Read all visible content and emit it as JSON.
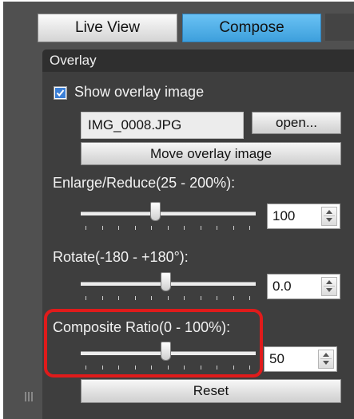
{
  "tabs": {
    "live_view": "Live View",
    "compose": "Compose",
    "active": "Compose"
  },
  "panel": {
    "title": "Overlay",
    "show_overlay": {
      "label": "Show overlay image",
      "checked": true
    },
    "file_name": "IMG_0008.JPG",
    "open_button": "open...",
    "move_button": "Move overlay image",
    "enlarge": {
      "label": "Enlarge/Reduce(25 - 200%):",
      "value": "100",
      "min": 25,
      "max": 200
    },
    "rotate": {
      "label": "Rotate(-180 - +180°):",
      "value": "0.0",
      "min": -180,
      "max": 180
    },
    "composite": {
      "label": "Composite Ratio(0 - 100%):",
      "value": "50",
      "min": 0,
      "max": 100
    },
    "reset_button": "Reset"
  },
  "colors": {
    "active_tab": "#4aaee8",
    "highlight": "#e01b1b",
    "panel_bg": "#3e3e3e"
  }
}
